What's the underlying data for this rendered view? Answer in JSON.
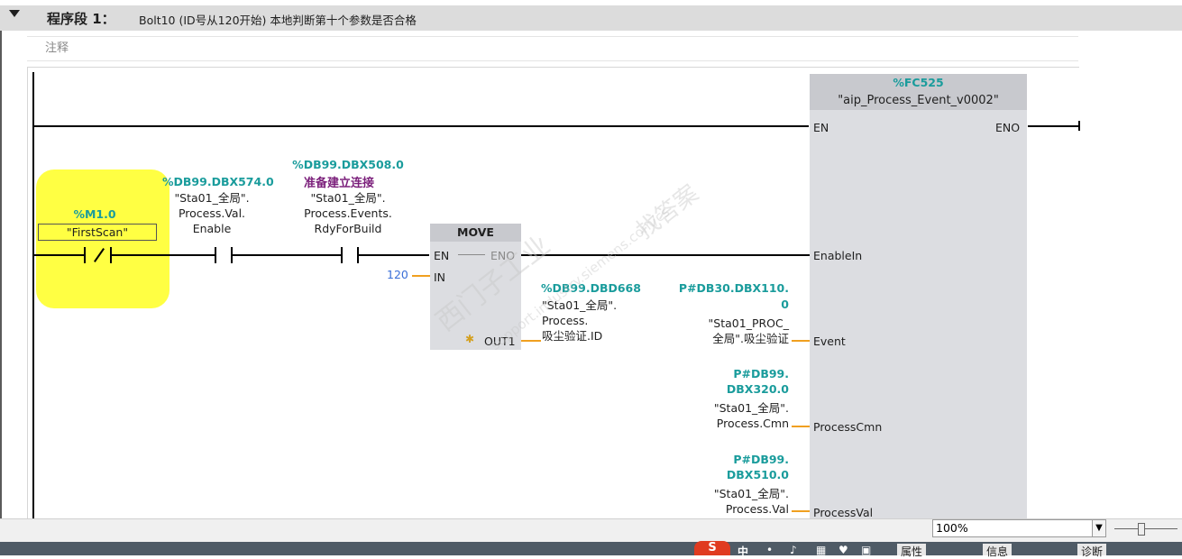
{
  "network": {
    "title": "程序段 1：",
    "description": "Bolt10   (ID号从120开始) 本地判断第十个参数是否合格",
    "comment": "注释"
  },
  "contact_firstscan": {
    "address": "%M1.0",
    "symbol": "\"FirstScan\""
  },
  "contact_enable": {
    "address": "%DB99.DBX574.0",
    "line1": "\"Sta01_全局\".",
    "line2": "Process.Val.",
    "line3": "Enable"
  },
  "contact_rdy": {
    "address": "%DB99.DBX508.0",
    "comment": "准备建立连接",
    "line1": "\"Sta01_全局\".",
    "line2": "Process.Events.",
    "line3": "RdyForBuild"
  },
  "move_block": {
    "title": "MOVE",
    "en": "EN",
    "eno": "ENO",
    "in": "IN",
    "out": "OUT1",
    "in_value": "120"
  },
  "move_out": {
    "address": "%DB99.DBD668",
    "line1": "\"Sta01_全局\".",
    "line2": "Process.",
    "line3": "吸尘验证.ID"
  },
  "fc_block": {
    "address": "%FC525",
    "name": "\"aip_Process_Event_v0002\"",
    "en": "EN",
    "eno": "ENO",
    "enablein": "EnableIn",
    "event": "Event",
    "processcmn": "ProcessCmn",
    "processval": "ProcessVal"
  },
  "param_event": {
    "address1": "P#DB30.DBX110.",
    "address2": "0",
    "line1": "\"Sta01_PROC_",
    "line2": "全局\".吸尘验证"
  },
  "param_cmn": {
    "address1": "P#DB99.",
    "address2": "DBX320.0",
    "line1": "\"Sta01_全局\".",
    "line2": "Process.Cmn"
  },
  "param_val": {
    "address1": "P#DB99.",
    "address2": "DBX510.0",
    "line1": "\"Sta01_全局\".",
    "line2": "Process.Val"
  },
  "watermark": {
    "text1": "西门子工业",
    "text2": "support.industry.siemens.com/cs",
    "text3": "找答案"
  },
  "zoom": {
    "value": "100%"
  },
  "taskbar": {
    "ime": "中",
    "props": "属性",
    "info": "信息",
    "diag": "诊断"
  }
}
